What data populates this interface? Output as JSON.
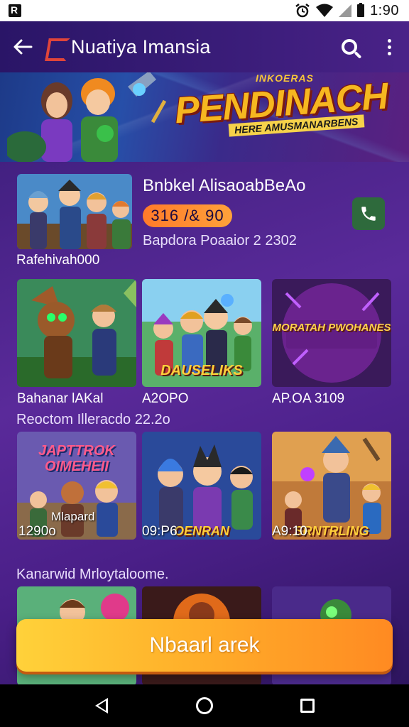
{
  "status_bar": {
    "time": "1:90",
    "app_icon": "r-app-icon",
    "icons": [
      "alarm-icon",
      "wifi-icon",
      "signal-icon",
      "battery-icon"
    ]
  },
  "app_bar": {
    "back_icon": "arrow-left-icon",
    "title": "Nuatiya Imansia",
    "search_icon": "search-icon",
    "more_icon": "more-vert-icon"
  },
  "hero": {
    "subtitle": "INKOERAS",
    "title": "PENDINACH",
    "tagline": "HERE AMUSMANARBENS"
  },
  "featured": {
    "title": "Bnbkel AlisaoabBeAo",
    "badge": "316 /& 90",
    "meta": "Bapdora Poaaior 2 2302",
    "caption": "Rafehivah000",
    "action_icon": "phone-icon"
  },
  "row1": [
    {
      "label": "Bahanar lAKal",
      "thumb_title": ""
    },
    {
      "label": "A2OPO",
      "thumb_title": "DAUSELIKS"
    },
    {
      "label": "AP.OA 3109",
      "thumb_title": "MORATAH PWOHANES"
    }
  ],
  "row1_caption": "Reoctom Illeracdo 22.2o",
  "row2": [
    {
      "label": "1290o",
      "thumb_title": "JAPTTROK OIMEHEII",
      "overlay": "Mlapard"
    },
    {
      "label": "09:P6",
      "thumb_title": "OENRAN"
    },
    {
      "label": "A9:10",
      "thumb_title": "SRNTRLING"
    }
  ],
  "row2_caption": "Kanarwid Mrloytaloome.",
  "cta": {
    "label": "Nbaarl arek"
  },
  "colors": {
    "app_bar": "#2a1567",
    "background": "#4a1f88",
    "cta_start": "#ffd23a",
    "cta_end": "#ff8a22",
    "badge": "#ff8a2a",
    "phone_button": "#2e6a3c"
  },
  "nav_bar": {
    "back_icon": "nav-back-icon",
    "home_icon": "nav-home-icon",
    "recents_icon": "nav-recents-icon"
  }
}
